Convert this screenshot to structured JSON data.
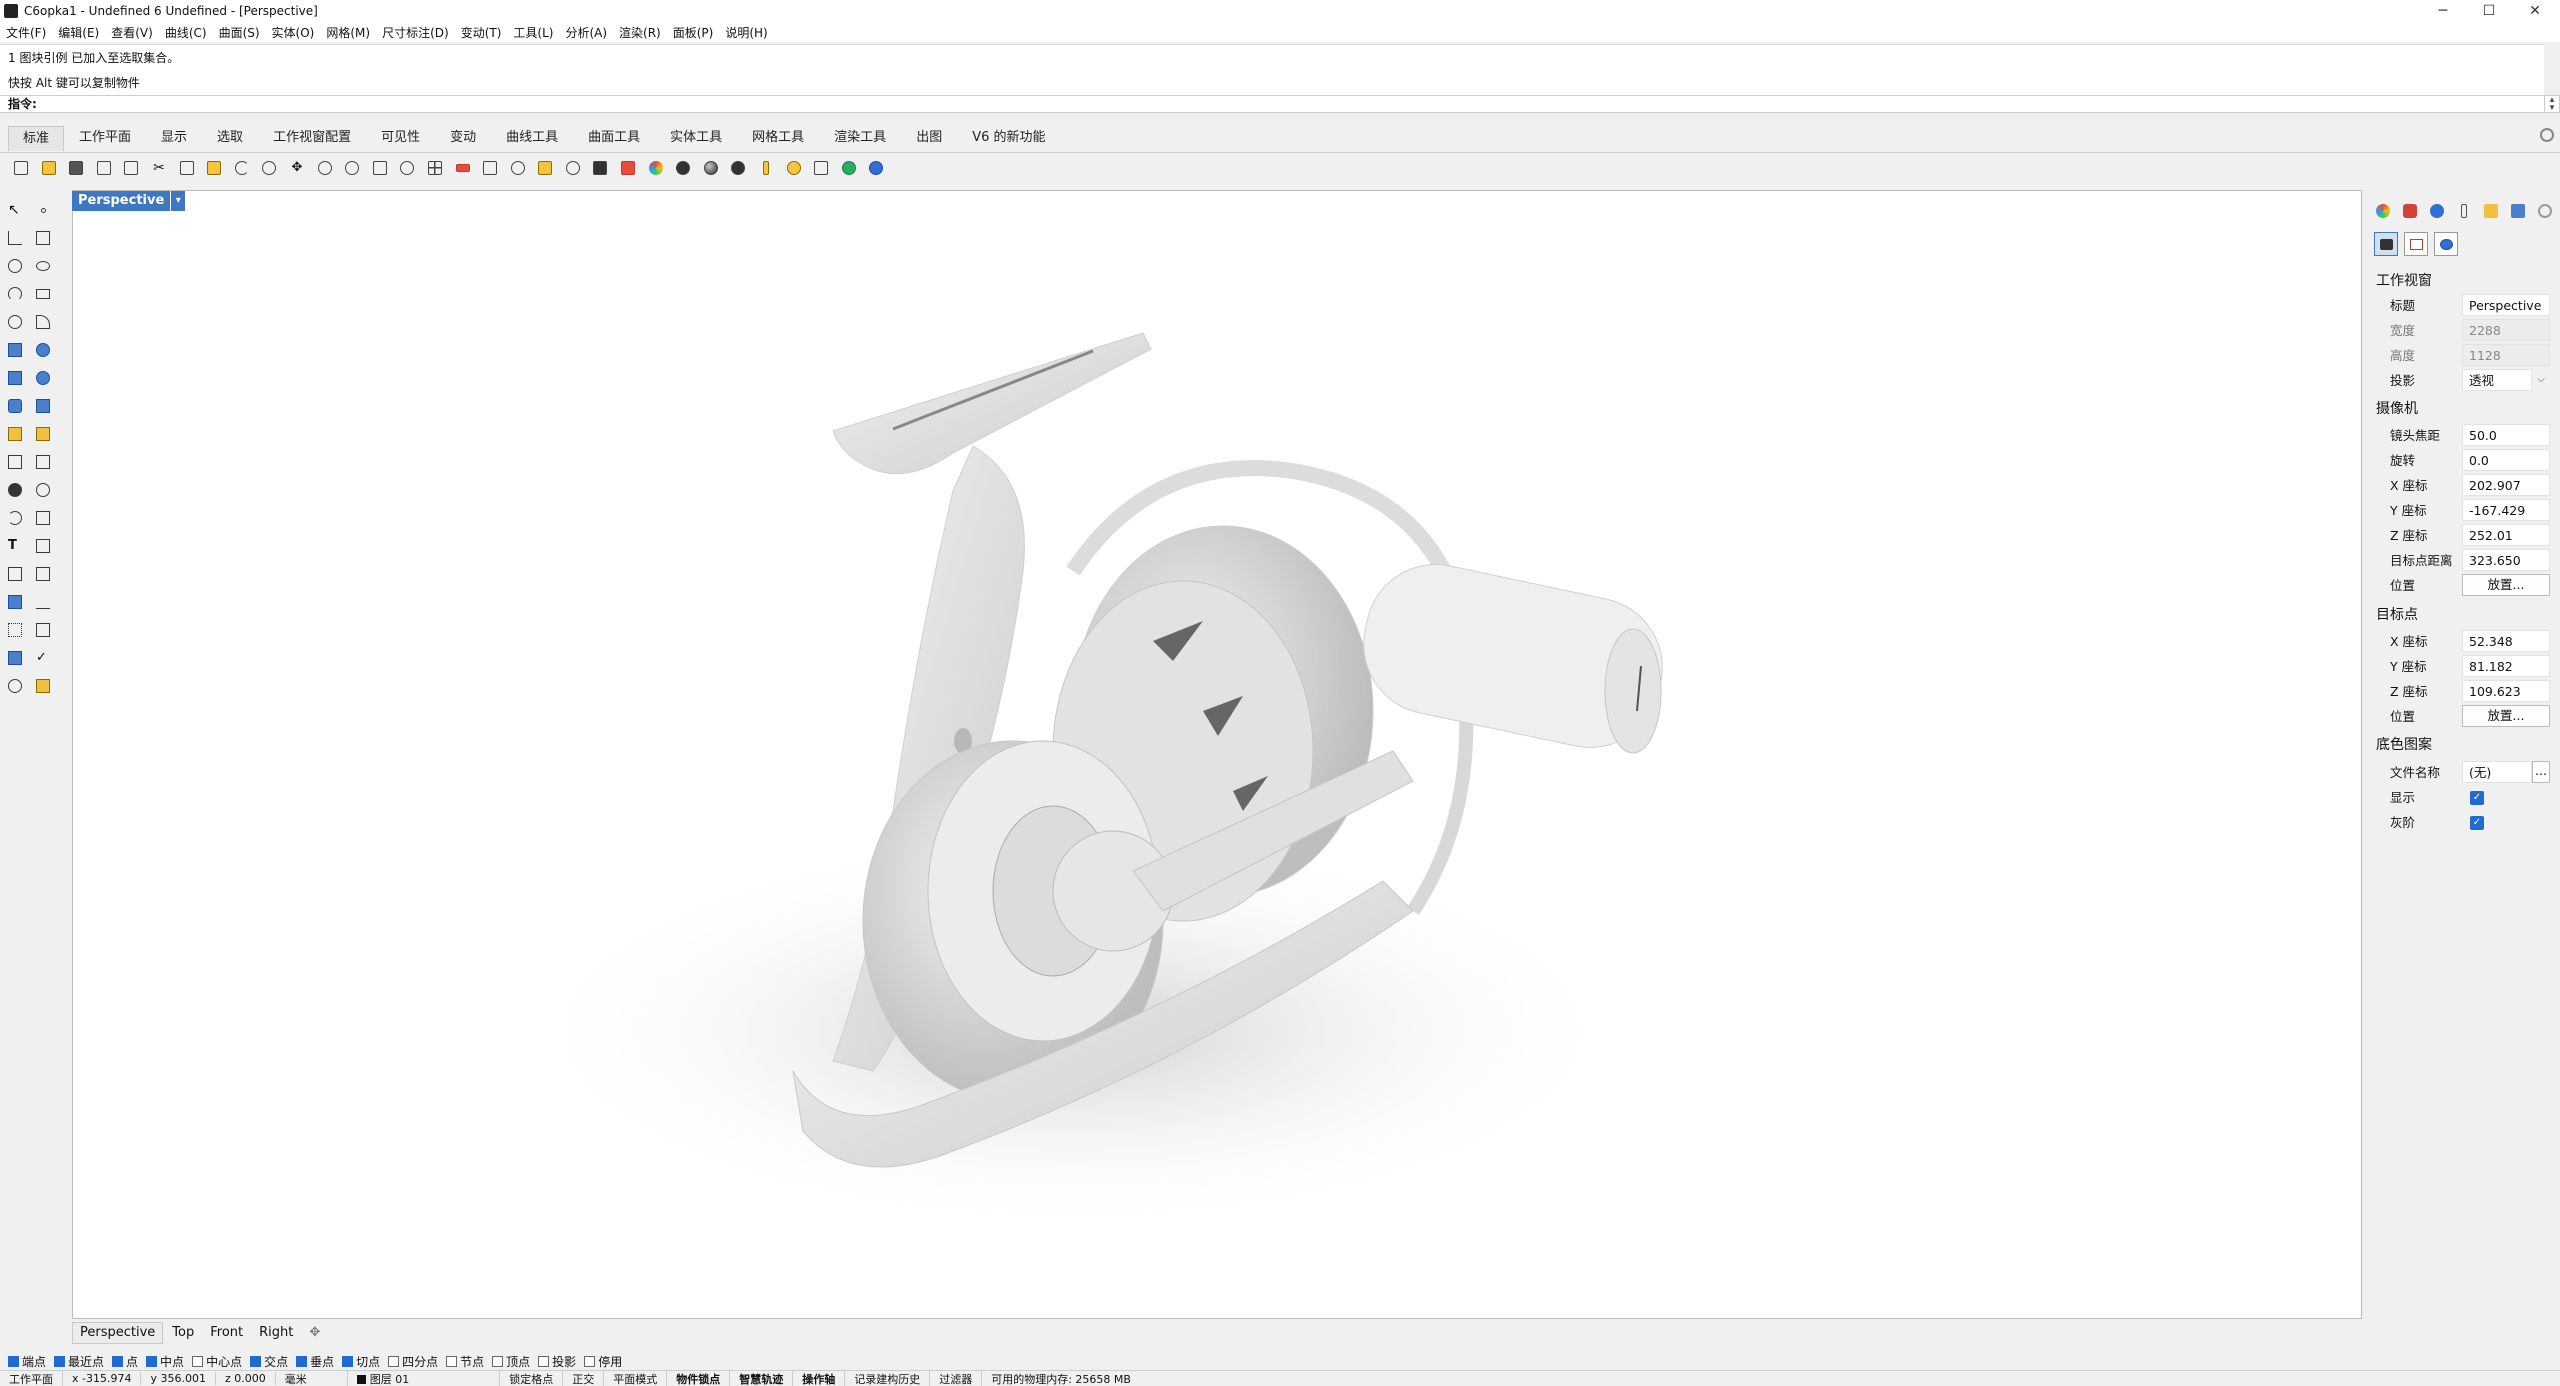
{
  "window": {
    "title": "C6opka1 - Undefined 6 Undefined - [Perspective]",
    "controls": {
      "minimize": "─",
      "maximize": "☐",
      "close": "✕"
    }
  },
  "menu": [
    "文件(F)",
    "编辑(E)",
    "查看(V)",
    "曲线(C)",
    "曲面(S)",
    "实体(O)",
    "网格(M)",
    "尺寸标注(D)",
    "变动(T)",
    "工具(L)",
    "分析(A)",
    "渲染(R)",
    "面板(P)",
    "说明(H)"
  ],
  "history": {
    "line1": "1 图块引例 已加入至选取集合。",
    "line2": "快按 Alt 键可以复制物件"
  },
  "command": {
    "prompt": "指令:"
  },
  "tabs": [
    "标准",
    "工作平面",
    "显示",
    "选取",
    "工作视窗配置",
    "可见性",
    "变动",
    "曲线工具",
    "曲面工具",
    "实体工具",
    "网格工具",
    "渲染工具",
    "出图",
    "V6 的新功能"
  ],
  "toolbar_icons": [
    "new-file-icon",
    "open-file-icon",
    "save-icon",
    "print-icon",
    "import-icon",
    "cut-icon",
    "copy-icon",
    "paste-icon",
    "undo-icon",
    "pan-hand-icon",
    "move-view-icon",
    "zoom-window-icon",
    "zoom-dynamic-icon",
    "zoom-extents-icon",
    "zoom-selected-icon",
    "four-viewports-icon",
    "set-cplane-icon",
    "grid-icon",
    "rotate-view-icon",
    "ortho-icon",
    "light-bulb-icon",
    "lock-icon",
    "render-shield-icon",
    "color-wheel-icon",
    "shaded-sphere-icon",
    "rendered-sphere-icon",
    "ghosted-sphere-icon",
    "pen-icon",
    "gear-options-icon",
    "snap-corner-icon",
    "render-globe-icon",
    "help-icon"
  ],
  "viewport": {
    "label": "Perspective",
    "label_arrow": "▾",
    "tabs": [
      "Perspective",
      "Top",
      "Front",
      "Right"
    ],
    "add_tab": "✥"
  },
  "osnap": [
    {
      "label": "端点",
      "checked": true
    },
    {
      "label": "最近点",
      "checked": true
    },
    {
      "label": "点",
      "checked": true
    },
    {
      "label": "中点",
      "checked": true
    },
    {
      "label": "中心点",
      "checked": false
    },
    {
      "label": "交点",
      "checked": true
    },
    {
      "label": "垂点",
      "checked": true
    },
    {
      "label": "切点",
      "checked": true
    },
    {
      "label": "四分点",
      "checked": false
    },
    {
      "label": "节点",
      "checked": false
    },
    {
      "label": "顶点",
      "checked": false
    },
    {
      "label": "投影",
      "checked": false
    },
    {
      "label": "停用",
      "checked": false
    }
  ],
  "status": {
    "cplane": "工作平面",
    "x": "x -315.974",
    "y": "y 356.001",
    "z": "z 0.000",
    "units": "毫米",
    "layer": "图层 01",
    "items": [
      "锁定格点",
      "正交",
      "平面模式",
      "物件锁点",
      "智慧轨迹",
      "操作轴",
      "记录建构历史",
      "过滤器",
      "可用的物理内存: 25658 MB"
    ]
  },
  "panel": {
    "section_viewport": "工作视窗",
    "title_label": "标题",
    "title_value": "Perspective",
    "width_label": "宽度",
    "width_value": "2288",
    "height_label": "高度",
    "height_value": "1128",
    "projection_label": "投影",
    "projection_value": "透视",
    "section_camera": "摄像机",
    "lens_label": "镜头焦距",
    "lens_value": "50.0",
    "rotation_label": "旋转",
    "rotation_value": "0.0",
    "cam_x_label": "X 座标",
    "cam_x_value": "202.907",
    "cam_y_label": "Y 座标",
    "cam_y_value": "-167.429",
    "cam_z_label": "Z 座标",
    "cam_z_value": "252.01",
    "target_dist_label": "目标点距离",
    "target_dist_value": "323.650",
    "cam_pos_label": "位置",
    "place_button": "放置...",
    "section_target": "目标点",
    "tgt_x_label": "X 座标",
    "tgt_x_value": "52.348",
    "tgt_y_label": "Y 座标",
    "tgt_y_value": "81.182",
    "tgt_z_label": "Z 座标",
    "tgt_z_value": "109.623",
    "tgt_pos_label": "位置",
    "section_wallpaper": "底色图案",
    "filename_label": "文件名称",
    "filename_value": "(无)",
    "browse_button": "...",
    "show_label": "显示",
    "show_checked": "✓",
    "gray_label": "灰阶",
    "gray_checked": "✓"
  }
}
